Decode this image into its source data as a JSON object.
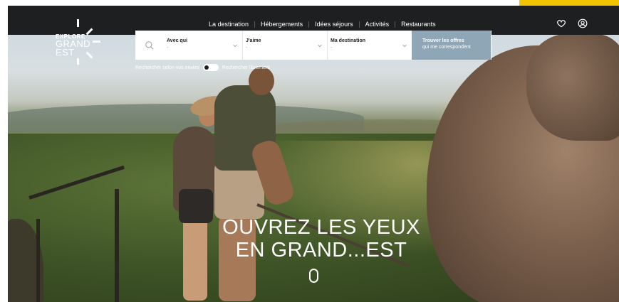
{
  "logo": {
    "line1": "EXPLORE",
    "line2": "GRAND",
    "line3": "EST"
  },
  "nav": {
    "items": [
      {
        "label": "La destination"
      },
      {
        "label": "Hébergements"
      },
      {
        "label": "Idées séjours"
      },
      {
        "label": "Activités"
      },
      {
        "label": "Restaurants"
      }
    ]
  },
  "header_icons": [
    "heart-icon",
    "user-icon"
  ],
  "search": {
    "fields": [
      {
        "label": "Avec qui",
        "value": "-"
      },
      {
        "label": "J'aime",
        "value": "-"
      },
      {
        "label": "Ma destination",
        "value": "-"
      }
    ],
    "button_line1": "Trouver les offres",
    "button_line2": "qui me correspondent",
    "button_color": "#8fa6b6"
  },
  "toggle": {
    "left_label": "Rechercher selon vos envies",
    "right_label": "Rechercher librement"
  },
  "hero": {
    "headline_line1": "OUVREZ LES YEUX",
    "headline_line2": "EN GRAND...EST"
  },
  "colors": {
    "accent": "#f2c300",
    "header_bg": "#1d1f20"
  }
}
